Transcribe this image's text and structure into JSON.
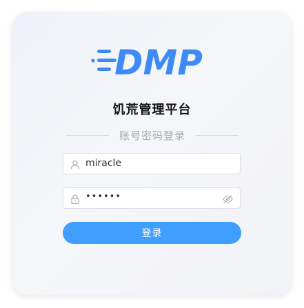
{
  "brand": {
    "logo_text": "DMP",
    "logo_color": "#3d8bf7"
  },
  "page": {
    "title": "饥荒管理平台",
    "login_method": "账号密码登录"
  },
  "form": {
    "username": {
      "value": "miracle",
      "icon": "user-icon"
    },
    "password": {
      "value": "••••••",
      "icon": "lock-icon",
      "toggle_icon": "eye-off-icon"
    },
    "submit_label": "登录"
  },
  "colors": {
    "primary": "#409eff",
    "title_text": "#111111",
    "muted_text": "#a8abb2"
  }
}
